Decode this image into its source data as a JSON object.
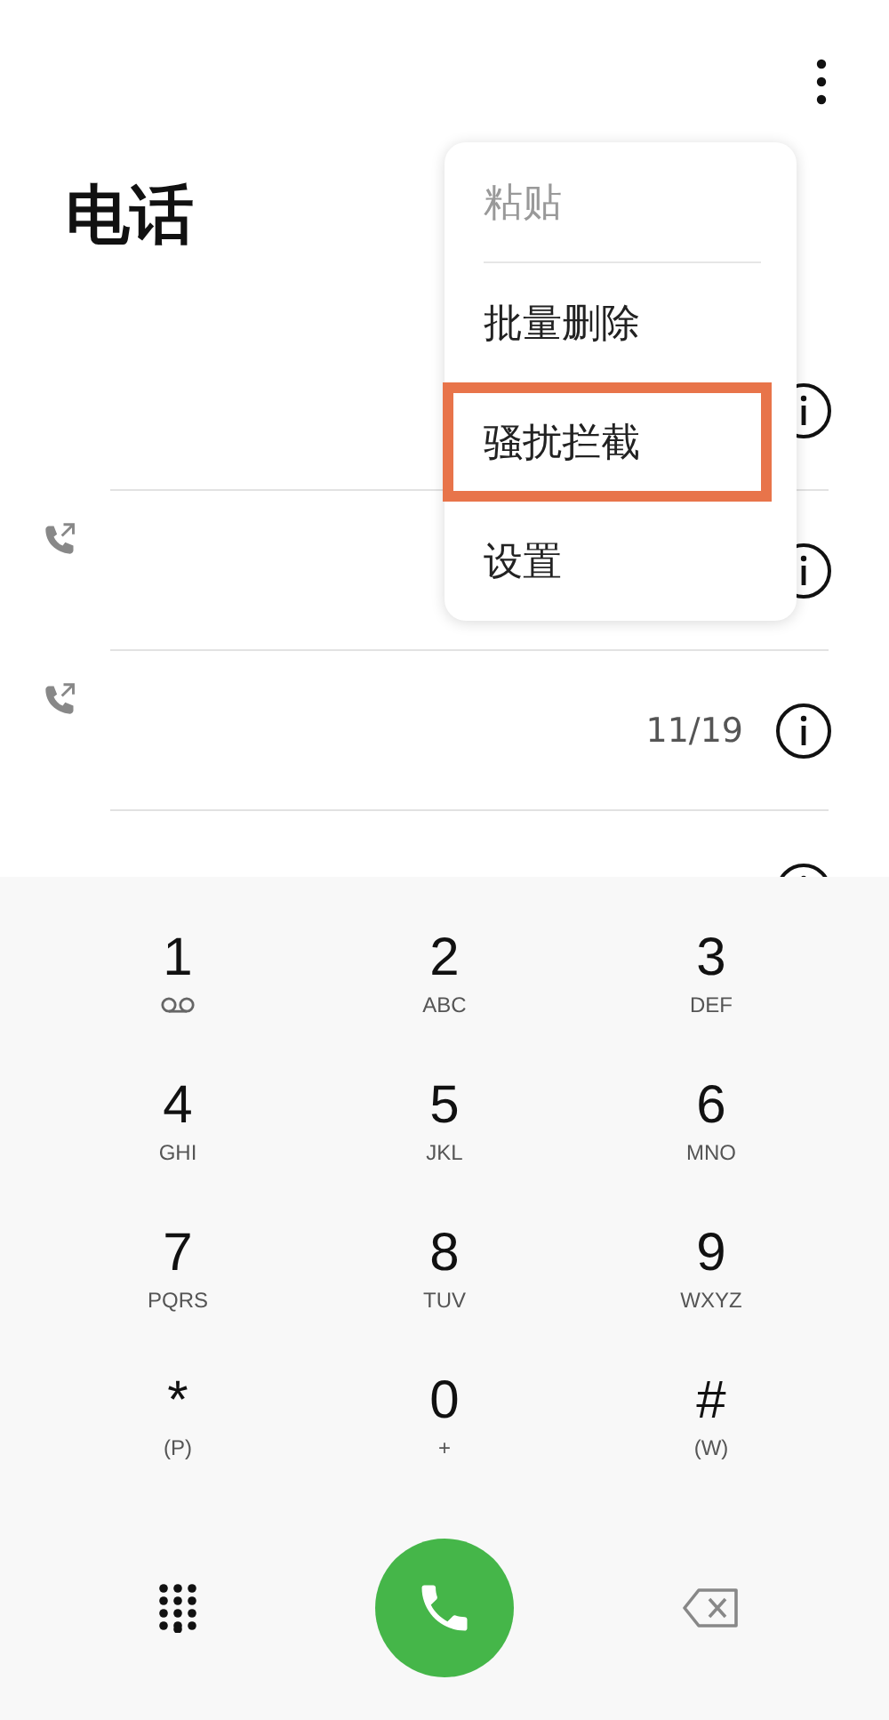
{
  "header": {
    "title": "电话"
  },
  "menu": {
    "items": [
      {
        "label": "粘贴",
        "disabled": true,
        "highlighted": false
      },
      {
        "label": "批量删除",
        "disabled": false,
        "highlighted": false
      },
      {
        "label": "骚扰拦截",
        "disabled": false,
        "highlighted": true
      },
      {
        "label": "设置",
        "disabled": false,
        "highlighted": false
      }
    ]
  },
  "call_log": [
    {
      "outgoing": false
    },
    {
      "outgoing": true
    },
    {
      "outgoing": true,
      "date": "11/19"
    },
    {
      "outgoing": false
    }
  ],
  "keypad": [
    {
      "digit": "1",
      "kind": "voicemail"
    },
    {
      "digit": "2",
      "kind": "letters",
      "letters": "ABC"
    },
    {
      "digit": "3",
      "kind": "letters",
      "letters": "DEF"
    },
    {
      "digit": "4",
      "kind": "letters",
      "letters": "GHI"
    },
    {
      "digit": "5",
      "kind": "letters",
      "letters": "JKL"
    },
    {
      "digit": "6",
      "kind": "letters",
      "letters": "MNO"
    },
    {
      "digit": "7",
      "kind": "letters",
      "letters": "PQRS"
    },
    {
      "digit": "8",
      "kind": "letters",
      "letters": "TUV"
    },
    {
      "digit": "9",
      "kind": "letters",
      "letters": "WXYZ"
    },
    {
      "digit": "*",
      "kind": "letters",
      "letters": "(P)"
    },
    {
      "digit": "0",
      "kind": "letters",
      "letters": "+"
    },
    {
      "digit": "#",
      "kind": "letters",
      "letters": "(W)"
    }
  ]
}
